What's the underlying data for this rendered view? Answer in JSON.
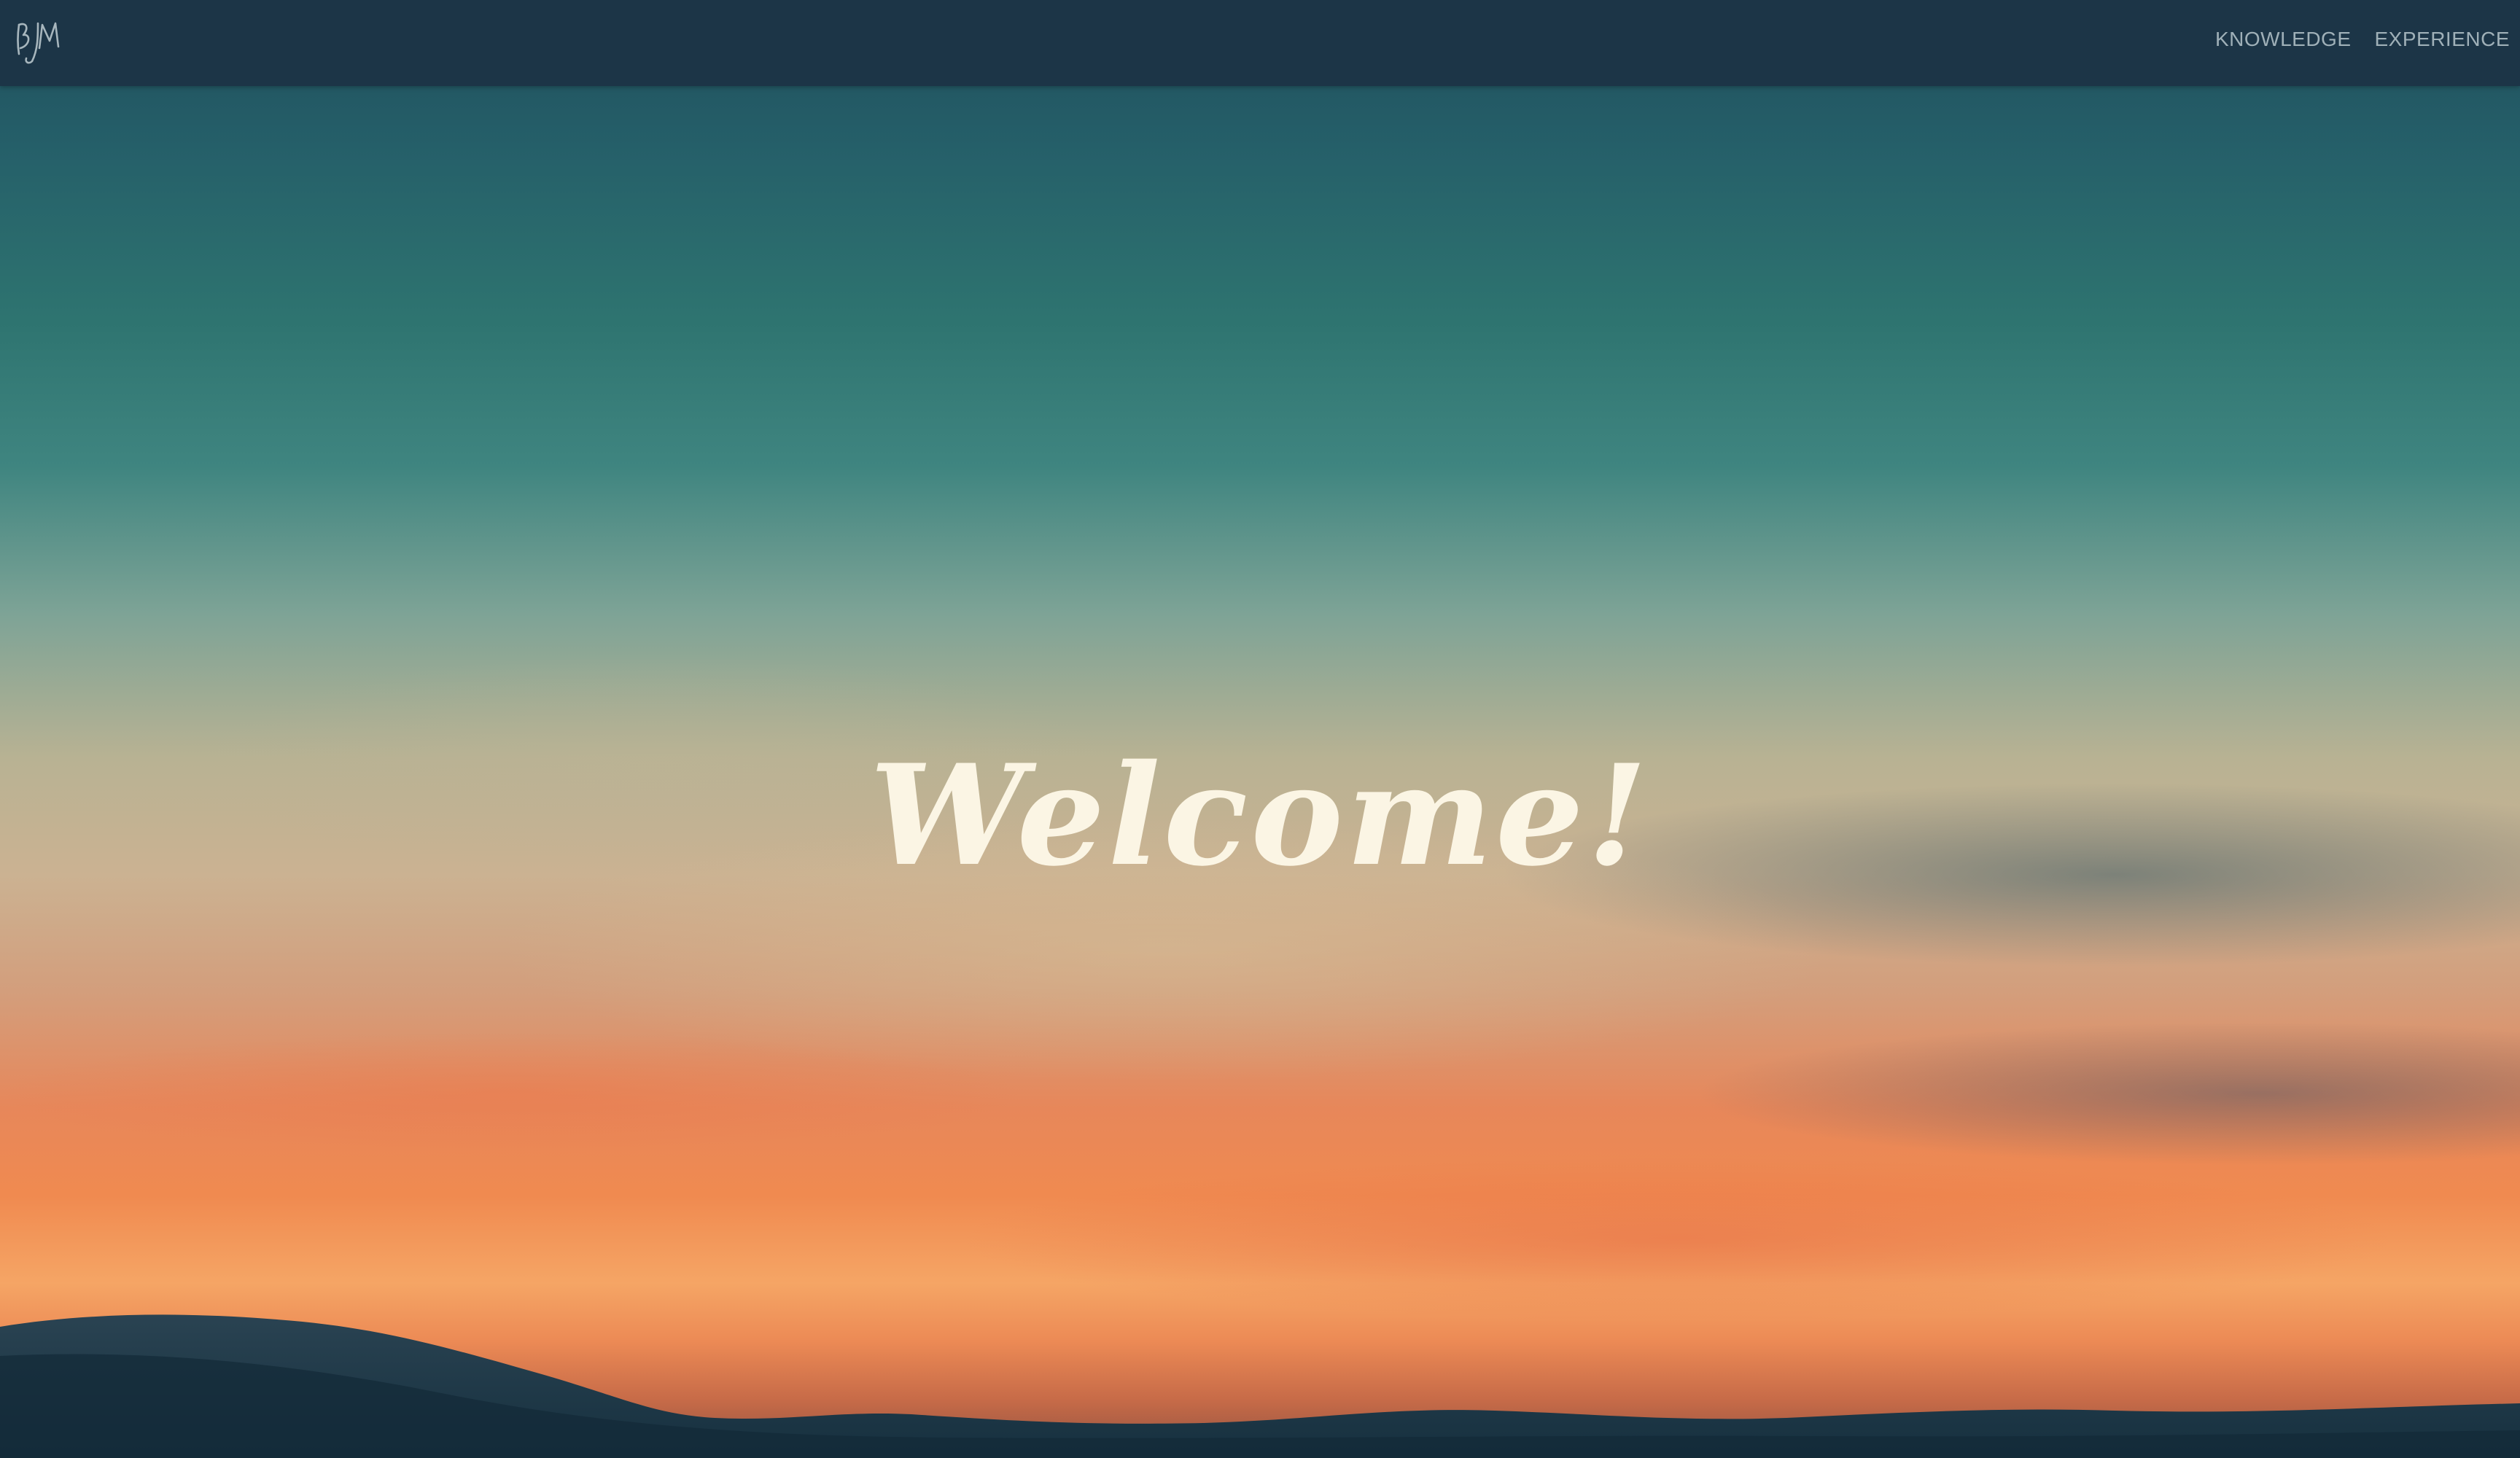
{
  "header": {
    "logo_text": "BJM",
    "nav": [
      {
        "label": "KNOWLEDGE"
      },
      {
        "label": "EXPERIENCE"
      }
    ]
  },
  "hero": {
    "title": "Welcome!"
  },
  "colors": {
    "topbar": "#1c3547",
    "nav_text": "#9fb0b8",
    "title_text": "#fbf5e4"
  }
}
